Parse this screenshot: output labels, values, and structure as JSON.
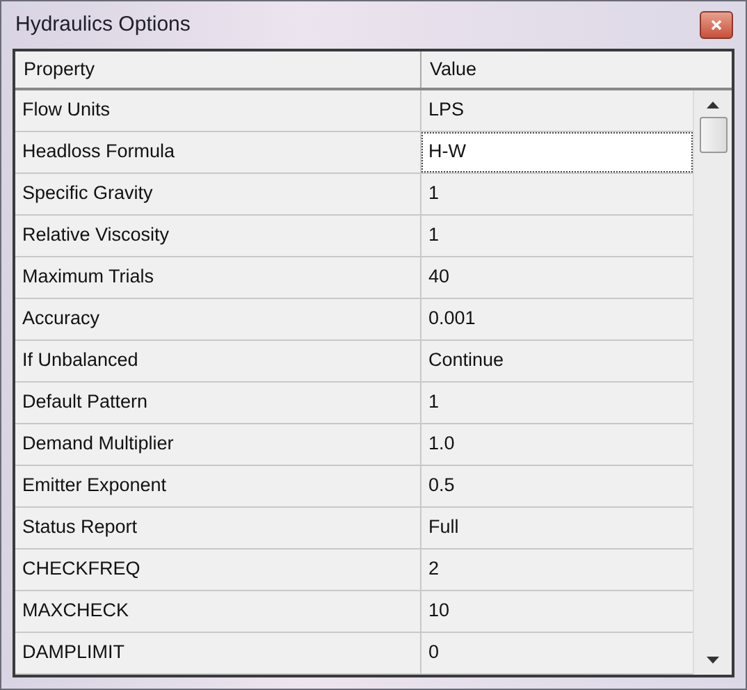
{
  "window": {
    "title": "Hydraulics Options"
  },
  "table": {
    "columns": [
      "Property",
      "Value"
    ],
    "rows": [
      {
        "property": "Flow Units",
        "value": "LPS",
        "selected": false
      },
      {
        "property": "Headloss Formula",
        "value": "H-W",
        "selected": true
      },
      {
        "property": "Specific Gravity",
        "value": "1",
        "selected": false
      },
      {
        "property": "Relative Viscosity",
        "value": "1",
        "selected": false
      },
      {
        "property": "Maximum Trials",
        "value": "40",
        "selected": false
      },
      {
        "property": "Accuracy",
        "value": "0.001",
        "selected": false
      },
      {
        "property": "If Unbalanced",
        "value": "Continue",
        "selected": false
      },
      {
        "property": "Default Pattern",
        "value": "1",
        "selected": false
      },
      {
        "property": "Demand Multiplier",
        "value": "1.0",
        "selected": false
      },
      {
        "property": "Emitter Exponent",
        "value": "0.5",
        "selected": false
      },
      {
        "property": "Status Report",
        "value": "Full",
        "selected": false
      },
      {
        "property": "CHECKFREQ",
        "value": "2",
        "selected": false
      },
      {
        "property": "MAXCHECK",
        "value": "10",
        "selected": false
      },
      {
        "property": "DAMPLIMIT",
        "value": "0",
        "selected": false
      }
    ]
  }
}
